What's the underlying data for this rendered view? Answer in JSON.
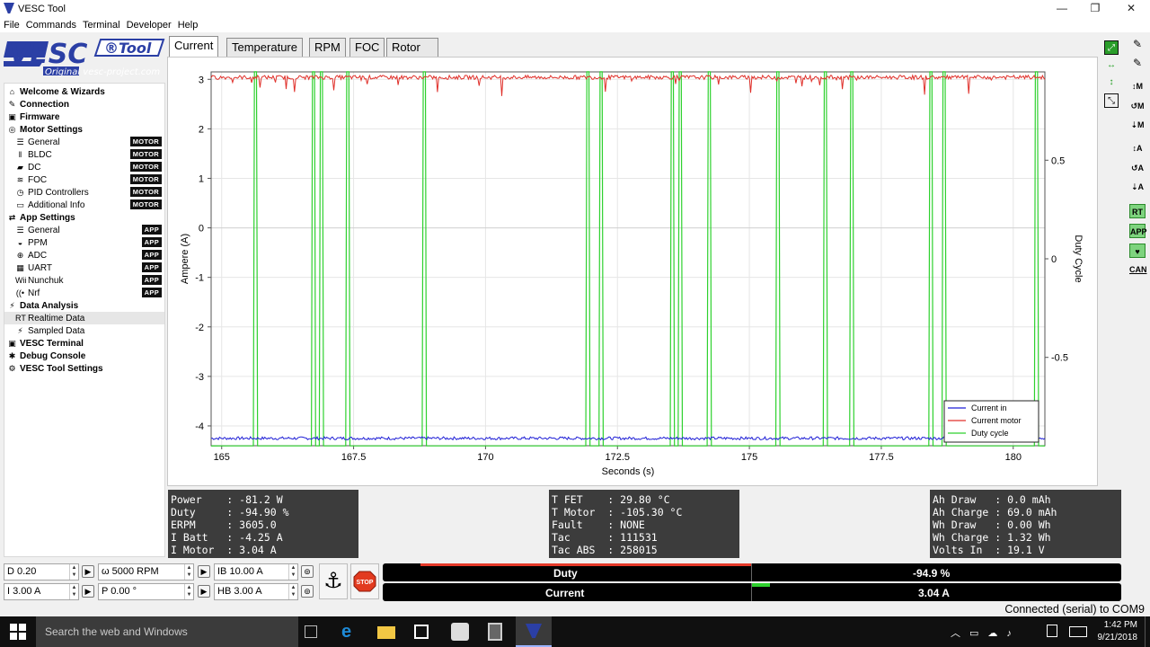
{
  "window": {
    "title": "VESC Tool",
    "minimize": "—",
    "maximize": "❐",
    "close": "✕"
  },
  "menu": [
    "File",
    "Commands",
    "Terminal",
    "Developer",
    "Help"
  ],
  "brand": {
    "main": "VESC",
    "tool": "®Tool",
    "sub": "Original  vesc-project.com"
  },
  "nav": [
    {
      "label": "Welcome & Wizards",
      "icon": "home-icon",
      "glyph": "⌂",
      "level": "top"
    },
    {
      "label": "Connection",
      "icon": "plug-icon",
      "glyph": "✎",
      "level": "top"
    },
    {
      "label": "Firmware",
      "icon": "chip-icon",
      "glyph": "▣",
      "level": "top"
    },
    {
      "label": "Motor Settings",
      "icon": "motor-icon",
      "glyph": "◎",
      "level": "top"
    },
    {
      "label": "General",
      "icon": "sliders-icon",
      "glyph": "☰",
      "level": "sub",
      "badge": "MOTOR"
    },
    {
      "label": "BLDC",
      "icon": "bldc-icon",
      "glyph": "ǁ",
      "level": "sub",
      "badge": "MOTOR"
    },
    {
      "label": "DC",
      "icon": "dc-icon",
      "glyph": "▰",
      "level": "sub",
      "badge": "MOTOR"
    },
    {
      "label": "FOC",
      "icon": "foc-icon",
      "glyph": "≋",
      "level": "sub",
      "badge": "MOTOR"
    },
    {
      "label": "PID Controllers",
      "icon": "pid-icon",
      "glyph": "◷",
      "level": "sub",
      "badge": "MOTOR"
    },
    {
      "label": "Additional Info",
      "icon": "info-icon",
      "glyph": "▭",
      "level": "sub",
      "badge": "MOTOR"
    },
    {
      "label": "App Settings",
      "icon": "app-icon",
      "glyph": "⇄",
      "level": "top"
    },
    {
      "label": "General",
      "icon": "sliders-icon",
      "glyph": "☰",
      "level": "sub",
      "badge": "APP"
    },
    {
      "label": "PPM",
      "icon": "gamepad-icon",
      "glyph": "◒",
      "level": "sub",
      "badge": "APP"
    },
    {
      "label": "ADC",
      "icon": "adc-icon",
      "glyph": "⊕",
      "level": "sub",
      "badge": "APP"
    },
    {
      "label": "UART",
      "icon": "keyboard-icon",
      "glyph": "▦",
      "level": "sub",
      "badge": "APP"
    },
    {
      "label": "Nunchuk",
      "icon": "wii-icon",
      "glyph": "Wii",
      "level": "sub",
      "badge": "APP"
    },
    {
      "label": "Nrf",
      "icon": "wireless-icon",
      "glyph": "((•",
      "level": "sub",
      "badge": "APP"
    },
    {
      "label": "Data Analysis",
      "icon": "analysis-icon",
      "glyph": "⚡",
      "level": "top"
    },
    {
      "label": "Realtime Data",
      "icon": "realtime-icon",
      "glyph": "RT",
      "level": "sub",
      "selected": true
    },
    {
      "label": "Sampled Data",
      "icon": "sampled-icon",
      "glyph": "⚡",
      "level": "sub"
    },
    {
      "label": "VESC Terminal",
      "icon": "terminal-icon",
      "glyph": "▣",
      "level": "top"
    },
    {
      "label": "Debug Console",
      "icon": "bug-icon",
      "glyph": "✱",
      "level": "top"
    },
    {
      "label": "VESC Tool Settings",
      "icon": "settings-icon",
      "glyph": "⚙",
      "level": "top"
    }
  ],
  "tabs": [
    "Current",
    "Temperature",
    "RPM",
    "FOC",
    "Rotor Position"
  ],
  "right_toolbar": [
    "↕M",
    "↺M",
    "⇣M",
    "↕A",
    "↺A",
    "⇣A",
    "RT",
    "APP",
    "♥",
    "CAN"
  ],
  "chart_data": {
    "type": "line",
    "xlabel": "Seconds (s)",
    "ylabel": "Ampere (A)",
    "y2label": "Duty Cycle",
    "xlim": [
      164.8,
      180.6
    ],
    "ylim": [
      -4.4,
      3.15
    ],
    "y2lim": [
      -0.948,
      0.948
    ],
    "x_ticks": [
      "165",
      "167.5",
      "170",
      "172.5",
      "175",
      "177.5",
      "180"
    ],
    "y_ticks": [
      "3",
      "2",
      "1",
      "0",
      "-1",
      "-2",
      "-3",
      "-4"
    ],
    "y2_ticks": [
      "0.5",
      "0",
      "-0.5"
    ],
    "grid": true,
    "legend_position": "bottom-right",
    "series": [
      {
        "name": "Current in",
        "color": "#1f1fd6",
        "approx_value": -4.25
      },
      {
        "name": "Current motor",
        "color": "#e0302a",
        "approx_value": 3.04
      },
      {
        "name": "Duty cycle",
        "color": "#2ed12e",
        "approx_value": -0.949,
        "spike_times": [
          165.6,
          166.7,
          166.85,
          167.35,
          168.8,
          171.9,
          172.15,
          173.5,
          173.65,
          174.2,
          175.5,
          176.4,
          176.9,
          178.4,
          178.65,
          180.4
        ]
      }
    ]
  },
  "info_left": [
    "Power    : -81.2 W",
    "Duty     : -94.90 %",
    "ERPM     : 3605.0",
    "I Batt   : -4.25 A",
    "I Motor  : 3.04 A"
  ],
  "info_mid": [
    "T FET    : 29.80 °C",
    "T Motor  : -105.30 °C",
    "Fault    : NONE",
    "Tac      : 111531",
    "Tac ABS  : 258015"
  ],
  "info_right": [
    "Ah Draw   : 0.0 mAh",
    "Ah Charge : 69.0 mAh",
    "Wh Draw   : 0.00 Wh",
    "Wh Charge : 1.32 Wh",
    "Volts In  : 19.1 V"
  ],
  "controls": {
    "duty": "D 0.20",
    "rpm": "ω 5000 RPM",
    "ib": "IB 10.00 A",
    "current": "I 3.00 A",
    "position": "P 0.00 °",
    "hb": "HB 3.00 A",
    "stop": "STOP"
  },
  "gauges": {
    "duty_label": "Duty",
    "duty_value": "-94.9 %",
    "duty_fraction": -0.949,
    "current_label": "Current",
    "current_value": "3.04 A",
    "current_fraction": 0.05
  },
  "status": "Connected (serial) to COM9",
  "taskbar": {
    "search": "Search the web and Windows",
    "time": "1:42 PM",
    "date": "9/21/2018"
  }
}
